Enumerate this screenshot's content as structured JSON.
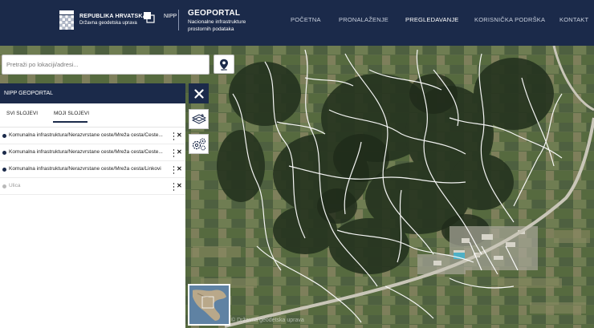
{
  "header": {
    "rh_title": "REPUBLIKA HRVATSKA",
    "rh_subtitle": "Državna geodetska uprava",
    "nipp_label": "NIPP",
    "portal_title": "GEOPORTAL",
    "portal_subtitle": "Nacionalne infrastrukture prostornih podataka",
    "nav": [
      {
        "label": "POČETNA",
        "active": false
      },
      {
        "label": "PRONALAŽENJE",
        "active": false
      },
      {
        "label": "PREGLEDAVANJE",
        "active": true
      },
      {
        "label": "KORISNIČKA PODRŠKA",
        "active": false
      },
      {
        "label": "KONTAKT",
        "active": false
      }
    ]
  },
  "search": {
    "placeholder": "Pretraži po lokaciji/adresi...",
    "value": ""
  },
  "panel": {
    "title": "NIPP GEOPORTAL",
    "tabs": [
      {
        "label": "SVI SLOJEVI",
        "active": false
      },
      {
        "label": "MOJI SLOJEVI",
        "active": true
      }
    ],
    "layers": [
      {
        "label": "Komunalna infrastruktura/Nerazvrstane ceste/Mreža cesta/Ceste...",
        "enabled": true
      },
      {
        "label": "Komunalna infrastruktura/Nerazvrstane ceste/Mreža cesta/Ceste...",
        "enabled": true
      },
      {
        "label": "Komunalna infrastruktura/Nerazvrstane ceste/Mreža cesta/Linkovi",
        "enabled": true
      },
      {
        "label": "Ulica",
        "enabled": false
      }
    ]
  },
  "icons": {
    "location": "location-pin-icon",
    "close": "close-icon",
    "layers": "layers-icon",
    "settings": "settings-icon"
  },
  "map": {
    "attribution": "© Državna geodetska uprava"
  },
  "colors": {
    "header_bg": "#1b2a4a",
    "road": "#ffffff"
  }
}
